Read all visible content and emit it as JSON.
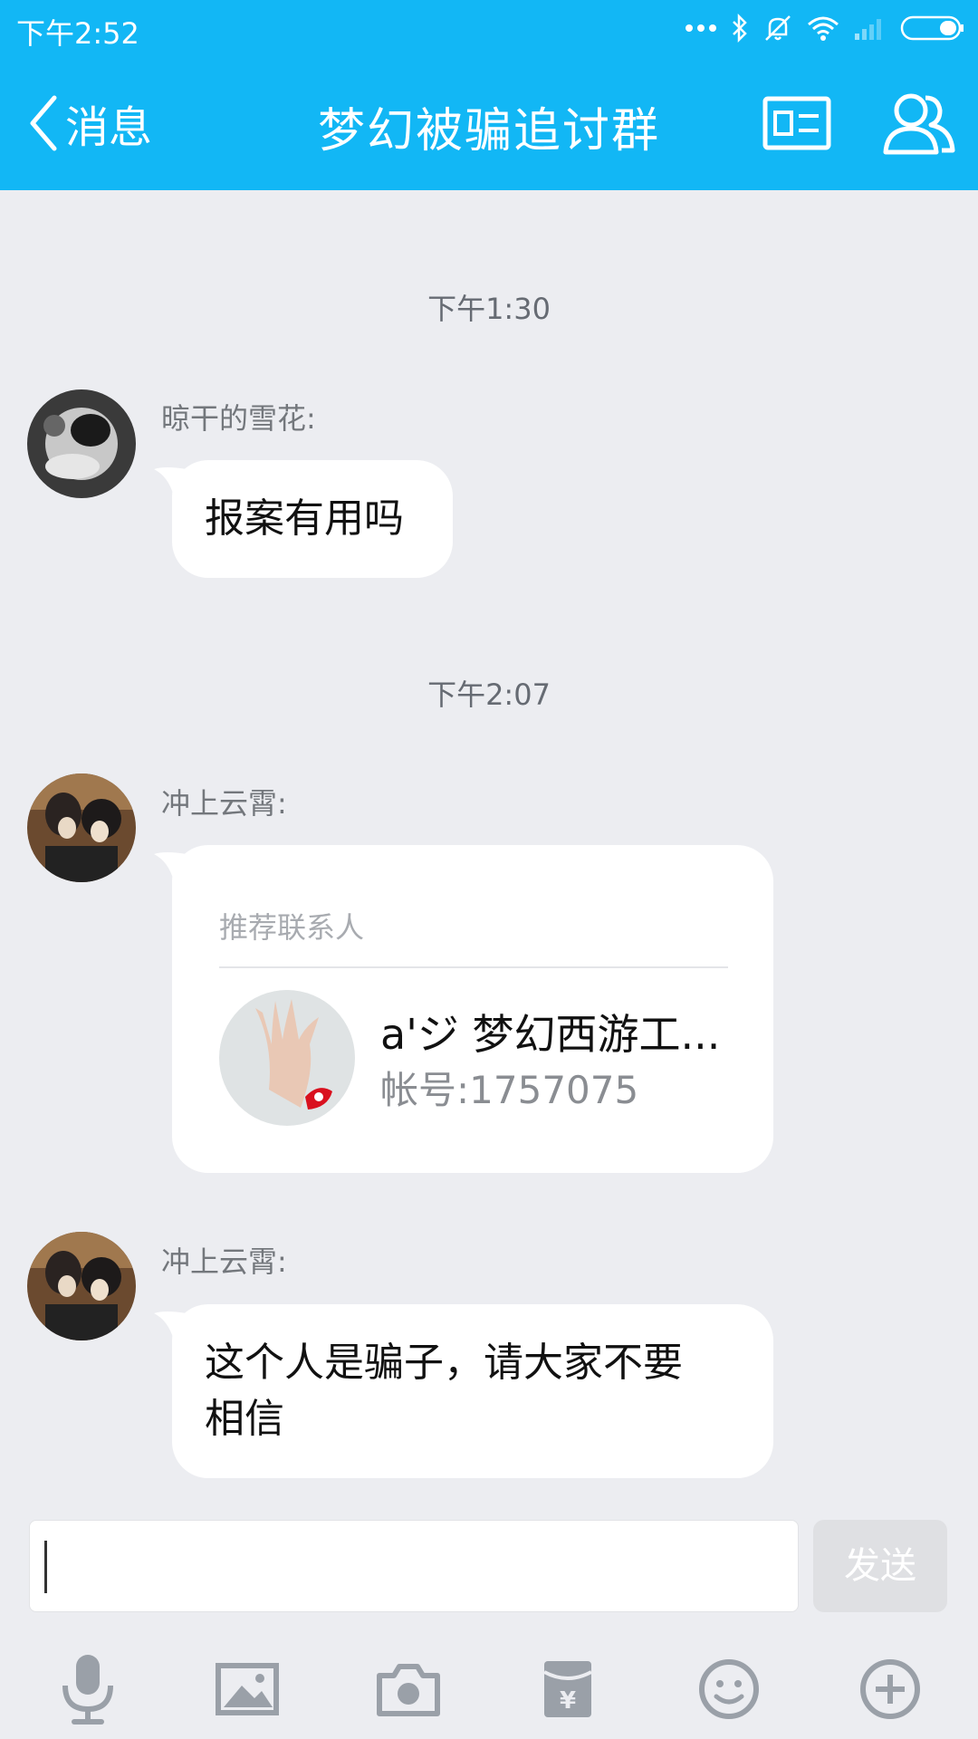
{
  "status": {
    "time": "下午2:52",
    "icons": [
      "more-dots-icon",
      "bluetooth-icon",
      "mute-icon",
      "wifi-icon",
      "signal-icon",
      "battery-icon"
    ]
  },
  "nav": {
    "back_label": "消息",
    "title": "梦幻被骗追讨群",
    "icons": [
      "group-card-icon",
      "members-icon"
    ]
  },
  "chat": {
    "messages": [
      {
        "timestamp": "下午1:30",
        "sender": "晾干的雪花:",
        "text": "报案有用吗"
      },
      {
        "timestamp": "下午2:07",
        "sender": "冲上云霄:",
        "card": {
          "label": "推荐联系人",
          "name": "a'ジ 梦幻西游工...",
          "account": "帐号:1757075"
        }
      },
      {
        "sender": "冲上云霄:",
        "text_line1": "这个人是骗子，请大家不要",
        "text_line2": "相信"
      }
    ]
  },
  "input": {
    "value": "",
    "send_label": "发送"
  },
  "toolbar": {
    "icons": [
      "microphone-icon",
      "image-icon",
      "camera-icon",
      "red-packet-icon",
      "emoji-icon",
      "plus-icon"
    ]
  },
  "colors": {
    "header": "#12b7f5",
    "background": "#ecedf1",
    "bubble": "#ffffff",
    "tool_icon": "#9aa0a8"
  }
}
